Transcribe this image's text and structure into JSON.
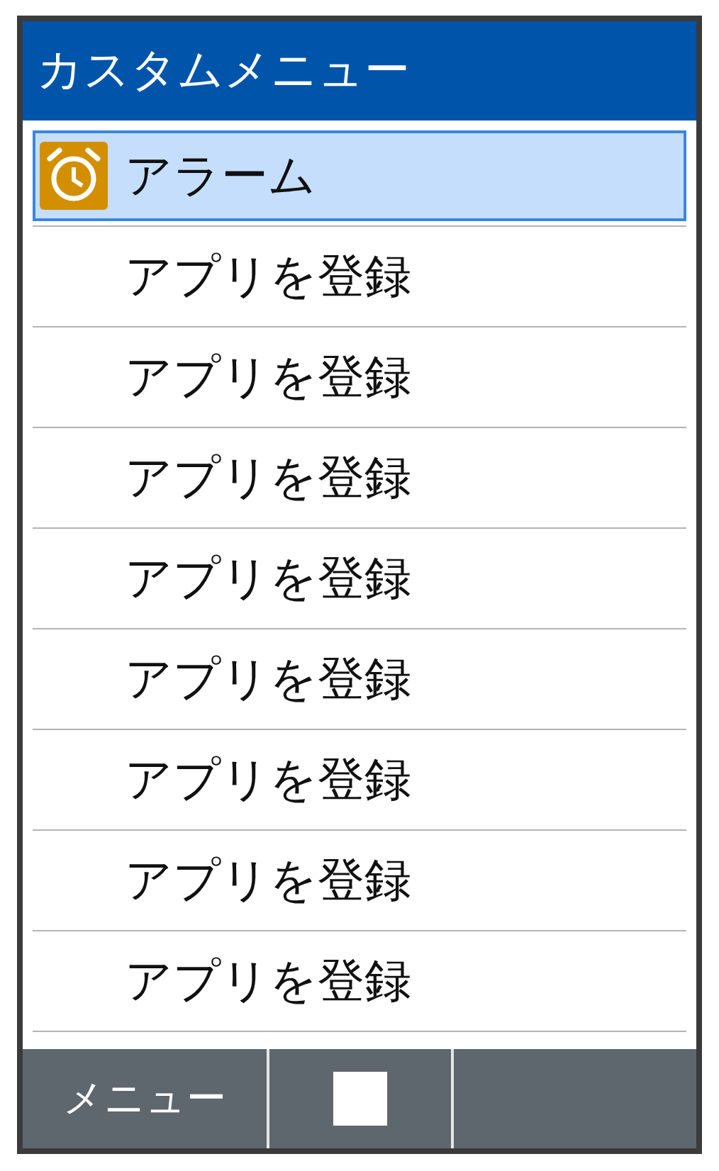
{
  "header": {
    "title": "カスタムメニュー"
  },
  "items": [
    {
      "label": "アラーム",
      "kind": "alarm",
      "selected": true
    },
    {
      "label": "アプリを登録",
      "kind": "empty",
      "selected": false
    },
    {
      "label": "アプリを登録",
      "kind": "empty",
      "selected": false
    },
    {
      "label": "アプリを登録",
      "kind": "empty",
      "selected": false
    },
    {
      "label": "アプリを登録",
      "kind": "empty",
      "selected": false
    },
    {
      "label": "アプリを登録",
      "kind": "empty",
      "selected": false
    },
    {
      "label": "アプリを登録",
      "kind": "empty",
      "selected": false
    },
    {
      "label": "アプリを登録",
      "kind": "empty",
      "selected": false
    },
    {
      "label": "アプリを登録",
      "kind": "empty",
      "selected": false
    }
  ],
  "softkeys": [
    {
      "kind": "text",
      "label": "メニュー"
    },
    {
      "kind": "square"
    },
    {
      "kind": "blank"
    }
  ]
}
